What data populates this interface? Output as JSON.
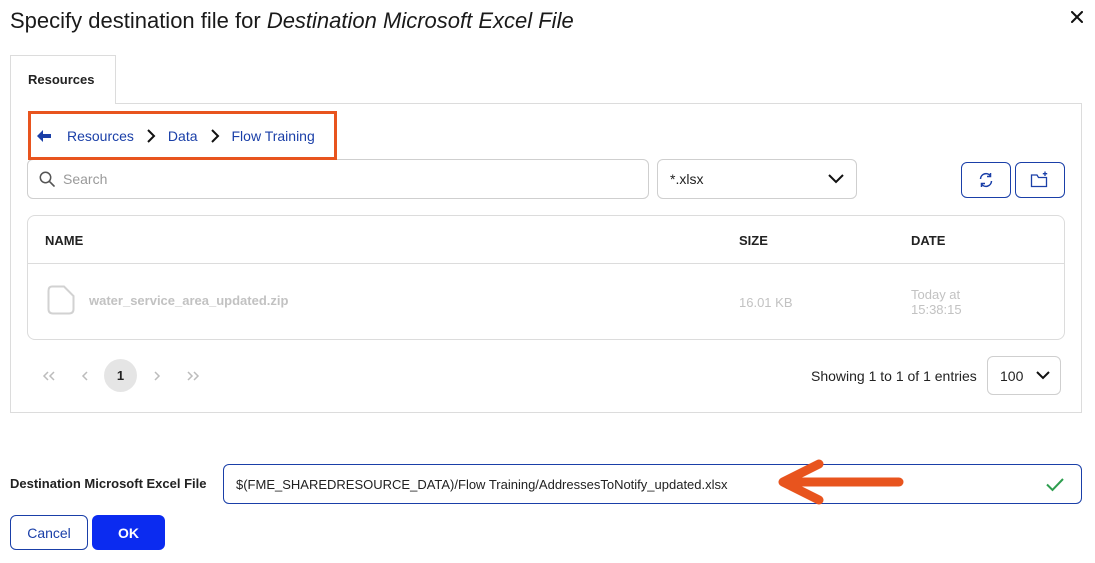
{
  "dialog": {
    "title_prefix": "Specify destination file for ",
    "title_emphasis": "Destination Microsoft Excel File"
  },
  "tabs": [
    {
      "label": "Resources"
    }
  ],
  "breadcrumb": {
    "items": [
      {
        "label": "Resources"
      },
      {
        "label": "Data"
      },
      {
        "label": "Flow Training"
      }
    ]
  },
  "search": {
    "placeholder": "Search",
    "value": ""
  },
  "filter": {
    "selected": "*.xlsx"
  },
  "toolbar": {
    "refresh_icon": "refresh-icon",
    "new_folder_icon": "new-folder-icon"
  },
  "table": {
    "headers": {
      "name": "NAME",
      "size": "SIZE",
      "date": "DATE"
    },
    "rows": [
      {
        "icon": "file-icon",
        "name": "water_service_area_updated.zip",
        "size": "16.01 KB",
        "date": "Today at 15:38:15"
      }
    ]
  },
  "pagination": {
    "current_page": "1",
    "summary": "Showing 1 to 1 of 1 entries",
    "page_size": "100"
  },
  "destination": {
    "label": "Destination Microsoft Excel File",
    "value": "$(FME_SHAREDRESOURCE_DATA)/Flow Training/AddressesToNotify_updated.xlsx"
  },
  "buttons": {
    "cancel": "Cancel",
    "ok": "OK"
  },
  "colors": {
    "accent": "#1a3fa8",
    "primary_button": "#0b2bf0",
    "annotation": "#e8541e",
    "valid_check": "#2e9e4f"
  }
}
